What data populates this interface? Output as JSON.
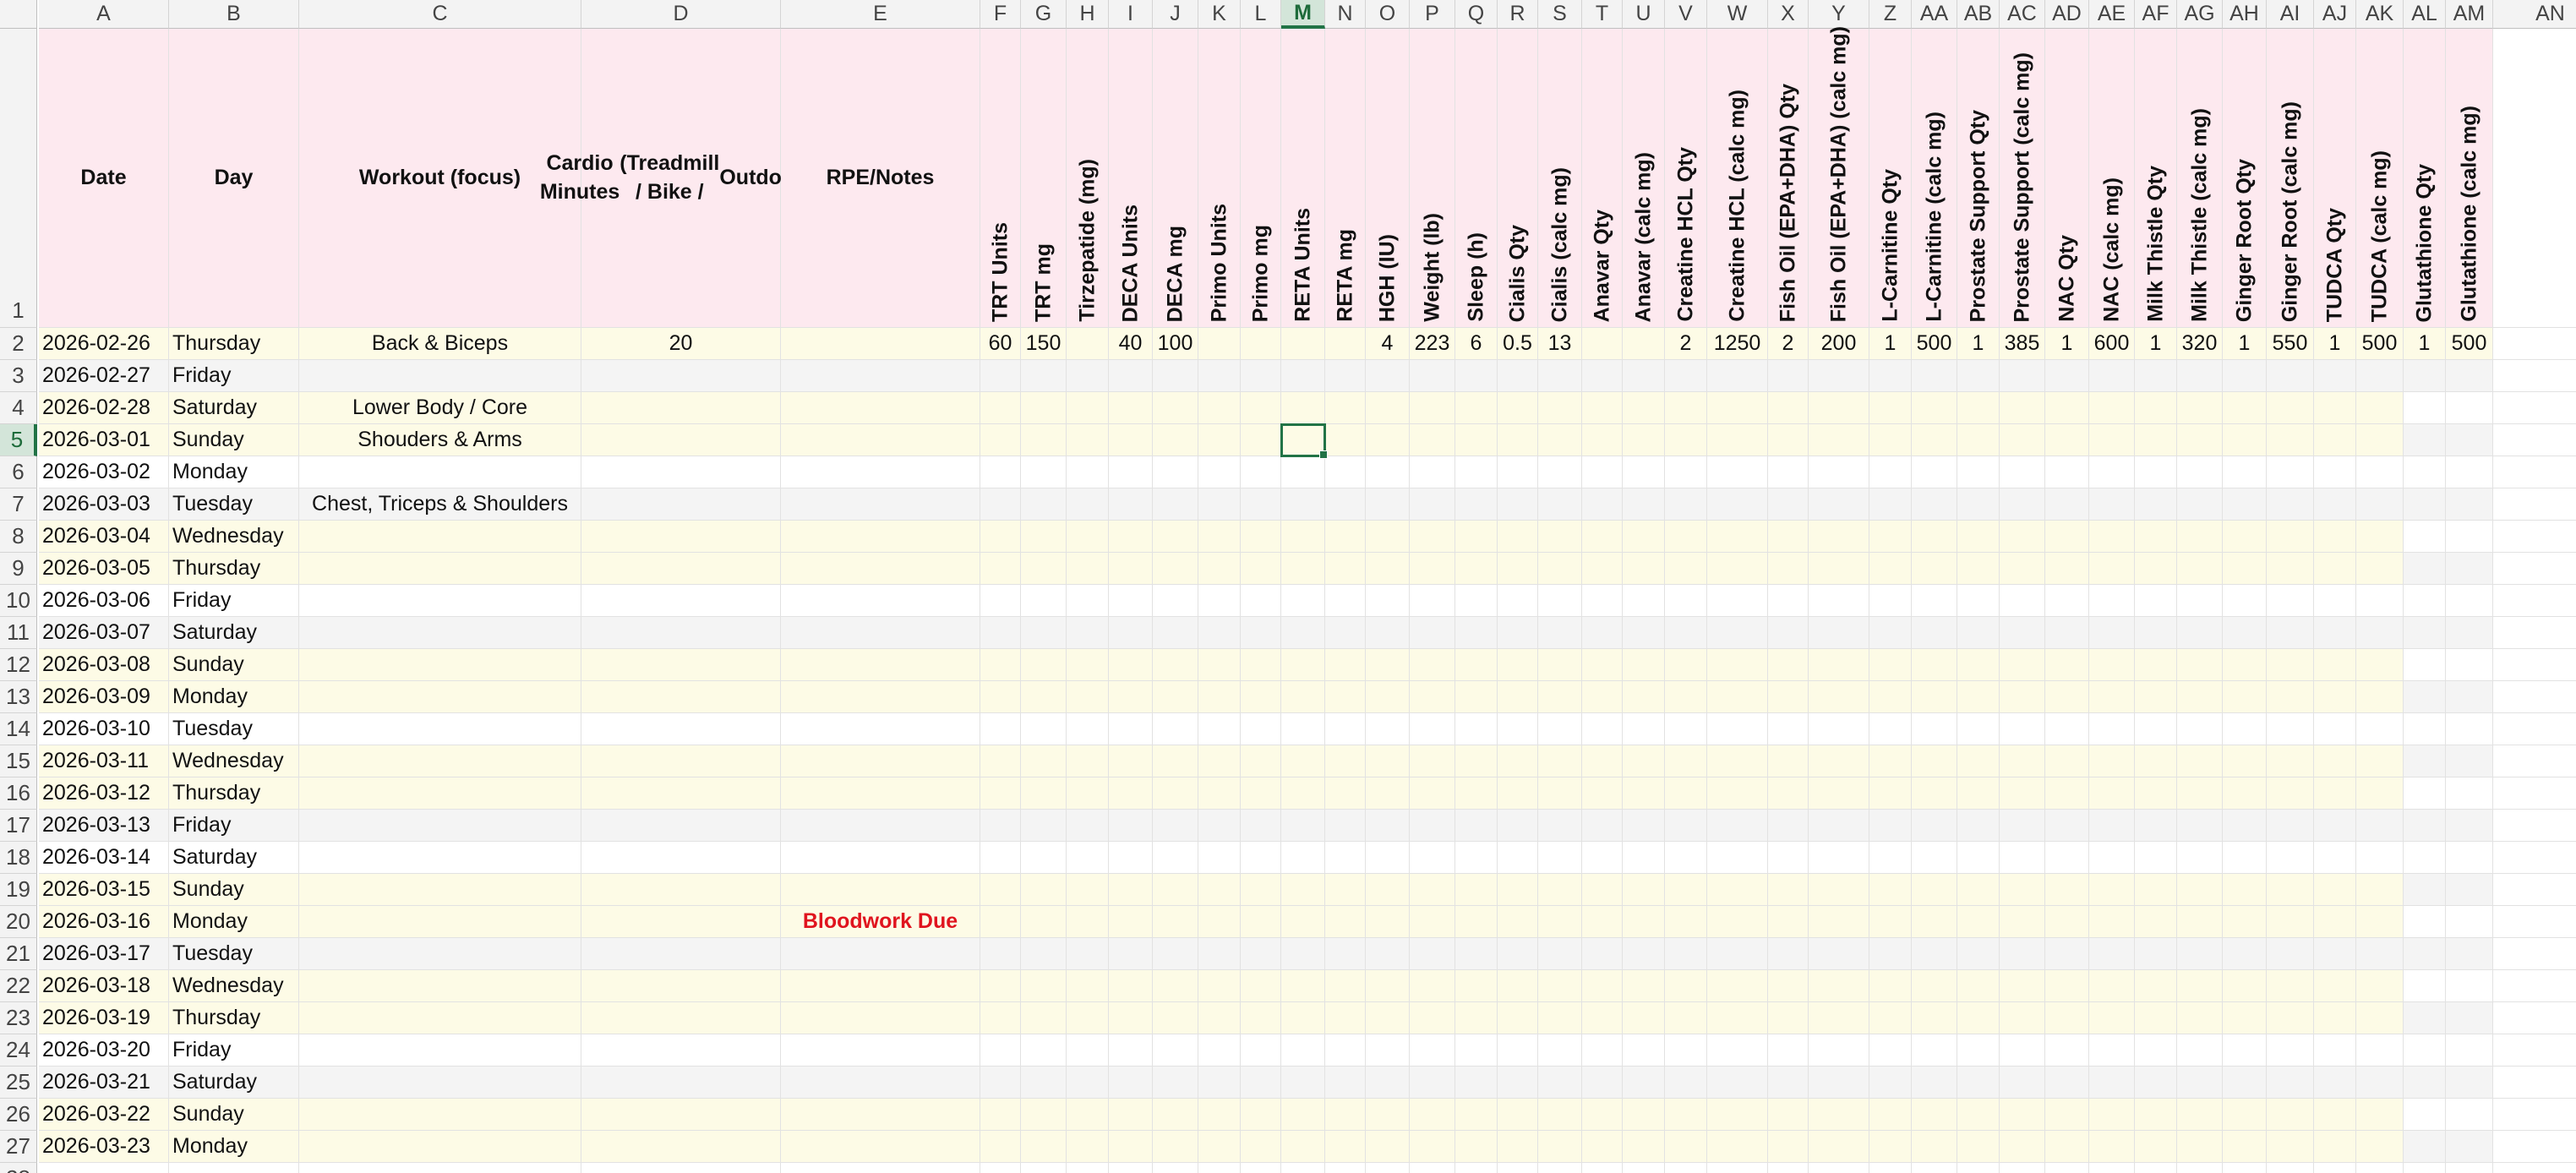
{
  "active_cell": "M5",
  "colors": {
    "header_pink": "#fde9ef",
    "row_yellow": "#fdfbe6",
    "row_white": "#ffffff",
    "row_gray": "#f4f4f4",
    "note_red": "#e0141e",
    "accent_green": "#217346"
  },
  "column_letters": [
    "A",
    "B",
    "C",
    "D",
    "E",
    "F",
    "G",
    "H",
    "I",
    "J",
    "K",
    "L",
    "M",
    "N",
    "O",
    "P",
    "Q",
    "R",
    "S",
    "T",
    "U",
    "V",
    "W",
    "X",
    "Y",
    "Z",
    "AA",
    "AB",
    "AC",
    "AD",
    "AE",
    "AF",
    "AG",
    "AH",
    "AI",
    "AJ",
    "AK",
    "AL",
    "AM",
    "AN"
  ],
  "headers": {
    "A": "Date",
    "B": "Day",
    "C": "Workout (focus)",
    "D_lines": [
      "Cardio Minutes",
      "(Treadmill / Bike /",
      "Outdoors)"
    ],
    "E": "RPE/Notes",
    "F": "TRT Units",
    "G": "TRT mg",
    "H": "Tirzepatide (mg)",
    "I": "DECA Units",
    "J": "DECA mg",
    "K": "Primo Units",
    "L": "Primo mg",
    "M": "RETA Units",
    "N": "RETA mg",
    "O": "HGH (IU)",
    "P": "Weight (lb)",
    "Q": "Sleep (h)",
    "R": "Cialis Qty",
    "S": "Cialis (calc mg)",
    "T": "Anavar Qty",
    "U": "Anavar (calc mg)",
    "V": "Creatine HCL Qty",
    "W": "Creatine HCL (calc mg)",
    "X": "Fish Oil (EPA+DHA) Qty",
    "Y": "Fish Oil (EPA+DHA) (calc mg)",
    "Z": "L-Carnitine Qty",
    "AA": "L-Carnitine (calc mg)",
    "AB": "Prostate Support Qty",
    "AC": "Prostate Support (calc mg)",
    "AD": "NAC Qty",
    "AE": "NAC (calc mg)",
    "AF": "Milk Thistle Qty",
    "AG": "Milk Thistle (calc mg)",
    "AH": "Ginger Root Qty",
    "AI": "Ginger Root (calc mg)",
    "AJ": "TUDCA Qty",
    "AK": "TUDCA (calc mg)",
    "AL": "Glutathione Qty",
    "AM": "Glutathione (calc mg)"
  },
  "rows": [
    {
      "n": "1"
    },
    {
      "n": "2",
      "A": "2026-02-26",
      "B": "Thursday",
      "C": "Back & Biceps",
      "D": "20",
      "F": "60",
      "G": "150",
      "I": "40",
      "J": "100",
      "O": "4",
      "P": "223",
      "Q": "6",
      "R": "0.5",
      "S": "13",
      "V": "2",
      "W": "1250",
      "X": "2",
      "Y": "200",
      "Z": "1",
      "AA": "500",
      "AB": "1",
      "AC": "385",
      "AD": "1",
      "AE": "600",
      "AF": "1",
      "AG": "320",
      "AH": "1",
      "AI": "550",
      "AJ": "1",
      "AK": "500",
      "AL": "1",
      "AM": "500"
    },
    {
      "n": "3",
      "A": "2026-02-27",
      "B": "Friday"
    },
    {
      "n": "4",
      "A": "2026-02-28",
      "B": "Saturday",
      "C": "Lower Body / Core"
    },
    {
      "n": "5",
      "A": "2026-03-01",
      "B": "Sunday",
      "C": "Shouders & Arms"
    },
    {
      "n": "6",
      "A": "2026-03-02",
      "B": "Monday"
    },
    {
      "n": "7",
      "A": "2026-03-03",
      "B": "Tuesday",
      "C": "Chest, Triceps & Shoulders"
    },
    {
      "n": "8",
      "A": "2026-03-04",
      "B": "Wednesday"
    },
    {
      "n": "9",
      "A": "2026-03-05",
      "B": "Thursday"
    },
    {
      "n": "10",
      "A": "2026-03-06",
      "B": "Friday"
    },
    {
      "n": "11",
      "A": "2026-03-07",
      "B": "Saturday"
    },
    {
      "n": "12",
      "A": "2026-03-08",
      "B": "Sunday"
    },
    {
      "n": "13",
      "A": "2026-03-09",
      "B": "Monday"
    },
    {
      "n": "14",
      "A": "2026-03-10",
      "B": "Tuesday"
    },
    {
      "n": "15",
      "A": "2026-03-11",
      "B": "Wednesday"
    },
    {
      "n": "16",
      "A": "2026-03-12",
      "B": "Thursday"
    },
    {
      "n": "17",
      "A": "2026-03-13",
      "B": "Friday"
    },
    {
      "n": "18",
      "A": "2026-03-14",
      "B": "Saturday"
    },
    {
      "n": "19",
      "A": "2026-03-15",
      "B": "Sunday"
    },
    {
      "n": "20",
      "A": "2026-03-16",
      "B": "Monday",
      "E": "Bloodwork Due"
    },
    {
      "n": "21",
      "A": "2026-03-17",
      "B": "Tuesday"
    },
    {
      "n": "22",
      "A": "2026-03-18",
      "B": "Wednesday"
    },
    {
      "n": "23",
      "A": "2026-03-19",
      "B": "Thursday"
    },
    {
      "n": "24",
      "A": "2026-03-20",
      "B": "Friday"
    },
    {
      "n": "25",
      "A": "2026-03-21",
      "B": "Saturday"
    },
    {
      "n": "26",
      "A": "2026-03-22",
      "B": "Sunday"
    },
    {
      "n": "27",
      "A": "2026-03-23",
      "B": "Monday"
    },
    {
      "n": "28"
    }
  ]
}
